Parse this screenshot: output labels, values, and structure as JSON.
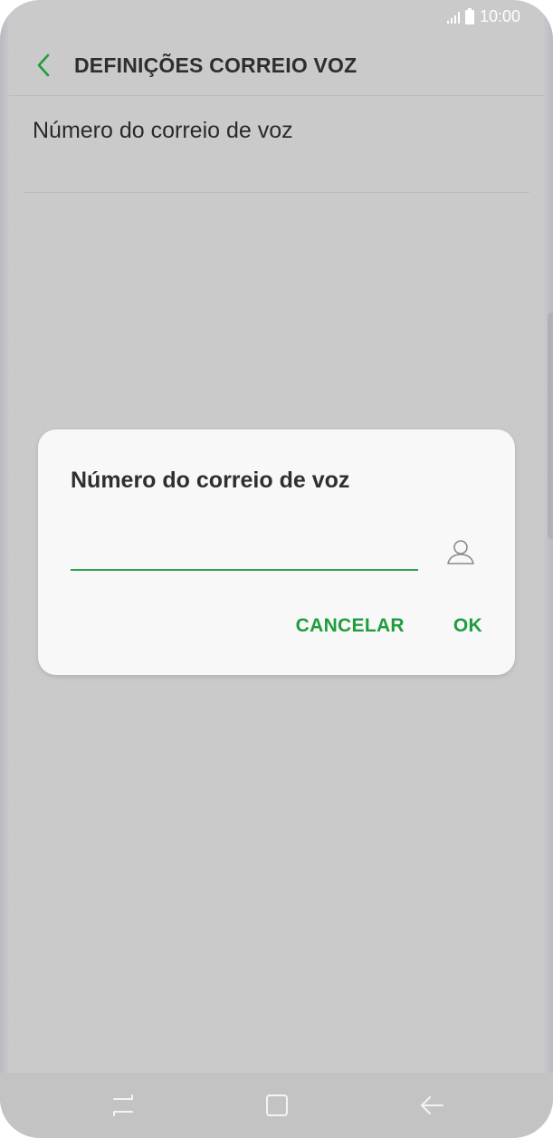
{
  "status_bar": {
    "time": "10:00",
    "icons": [
      "signal-icon",
      "battery-icon"
    ]
  },
  "header": {
    "title": "DEFINIÇÕES CORREIO VOZ",
    "back_icon": "chevron-left-icon",
    "accent_color": "#1f9d3e"
  },
  "list": {
    "items": [
      {
        "label": "Número do correio de voz"
      }
    ]
  },
  "dialog": {
    "title": "Número do correio de voz",
    "input_value": "",
    "input_placeholder": "",
    "contact_icon": "contact-person-icon",
    "cancel_label": "CANCELAR",
    "ok_label": "OK",
    "accent_color": "#1f9d3e"
  },
  "nav_bar": {
    "buttons": [
      "recent-apps-icon",
      "home-icon",
      "back-arrow-icon"
    ]
  }
}
